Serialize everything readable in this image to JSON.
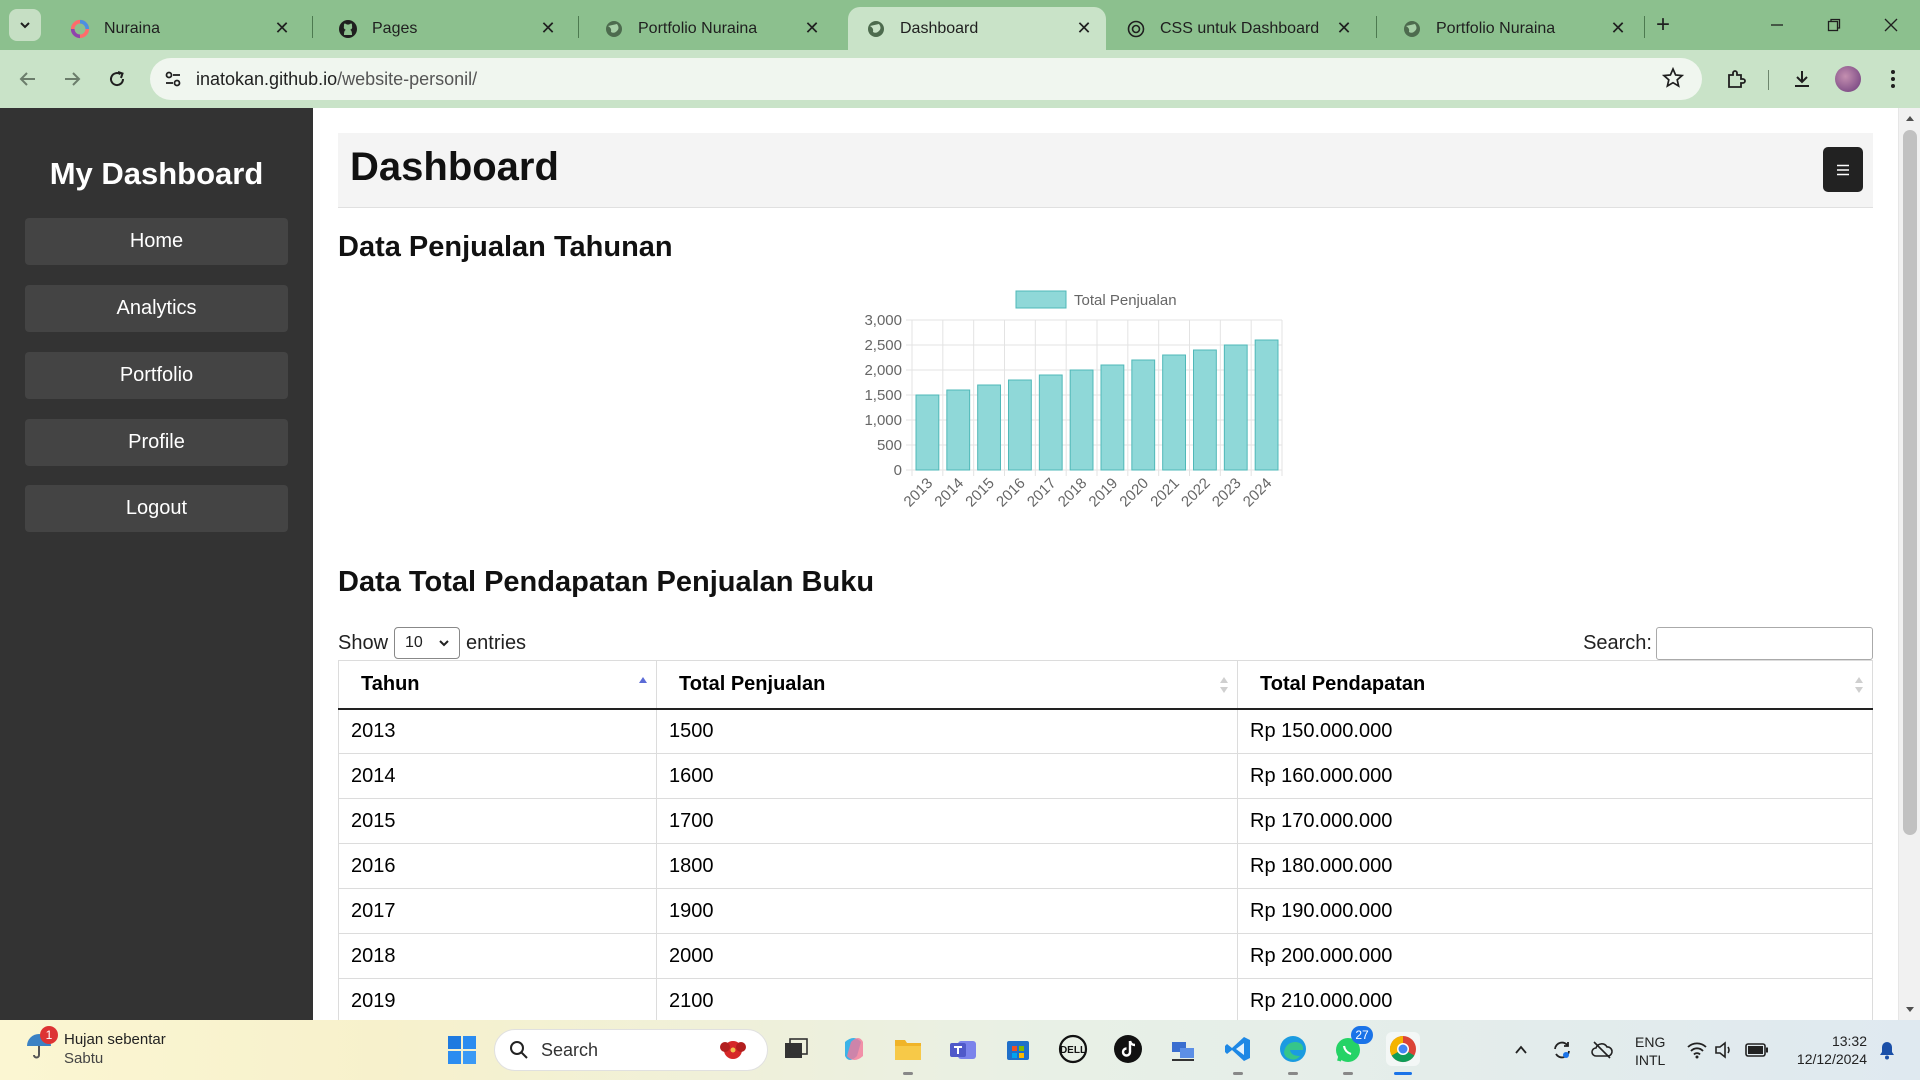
{
  "browser": {
    "tabs": [
      {
        "title": "Nuraina",
        "active": false
      },
      {
        "title": "Pages",
        "active": false
      },
      {
        "title": "Portfolio Nuraina",
        "active": false
      },
      {
        "title": "Dashboard",
        "active": true
      },
      {
        "title": "CSS untuk Dashboard",
        "active": false
      },
      {
        "title": "Portfolio Nuraina",
        "active": false
      }
    ],
    "url_host": "inatokan.github.io",
    "url_path": "/website-personil/"
  },
  "sidebar": {
    "title": "My Dashboard",
    "items": [
      {
        "label": "Home"
      },
      {
        "label": "Analytics"
      },
      {
        "label": "Portfolio"
      },
      {
        "label": "Profile"
      },
      {
        "label": "Logout"
      }
    ]
  },
  "header": {
    "title": "Dashboard",
    "menu_icon": "menu-icon"
  },
  "sales_section": {
    "heading": "Data Penjualan Tahunan"
  },
  "chart_data": {
    "type": "bar",
    "title": "",
    "xlabel": "",
    "ylabel": "",
    "categories": [
      "2013",
      "2014",
      "2015",
      "2016",
      "2017",
      "2018",
      "2019",
      "2020",
      "2021",
      "2022",
      "2023",
      "2024"
    ],
    "series": [
      {
        "name": "Total Penjualan",
        "values": [
          1500,
          1600,
          1700,
          1800,
          1900,
          2000,
          2100,
          2200,
          2300,
          2400,
          2500,
          2600
        ]
      }
    ],
    "ylim": [
      0,
      3000
    ],
    "yticks": [
      "0",
      "500",
      "1,000",
      "1,500",
      "2,000",
      "2,500",
      "3,000"
    ],
    "grid": true,
    "legend": "top",
    "colors": {
      "fill": "#8fd8d8",
      "stroke": "#4fb8b8"
    }
  },
  "revenue_section": {
    "heading": "Data Total Pendapatan Penjualan Buku",
    "show_label": "Show",
    "entries_label": "entries",
    "page_length": "10",
    "search_label": "Search:",
    "columns": [
      "Tahun",
      "Total Penjualan",
      "Total Pendapatan"
    ],
    "rows": [
      [
        "2013",
        "1500",
        "Rp 150.000.000"
      ],
      [
        "2014",
        "1600",
        "Rp 160.000.000"
      ],
      [
        "2015",
        "1700",
        "Rp 170.000.000"
      ],
      [
        "2016",
        "1800",
        "Rp 180.000.000"
      ],
      [
        "2017",
        "1900",
        "Rp 190.000.000"
      ],
      [
        "2018",
        "2000",
        "Rp 200.000.000"
      ],
      [
        "2019",
        "2100",
        "Rp 210.000.000"
      ]
    ]
  },
  "taskbar": {
    "weather_title": "Hujan sebentar",
    "weather_sub": "Sabtu",
    "weather_badge": "1",
    "search_placeholder": "Search",
    "whatsapp_badge": "27",
    "lang_line1": "ENG",
    "lang_line2": "INTL",
    "time": "13:32",
    "date": "12/12/2024"
  }
}
